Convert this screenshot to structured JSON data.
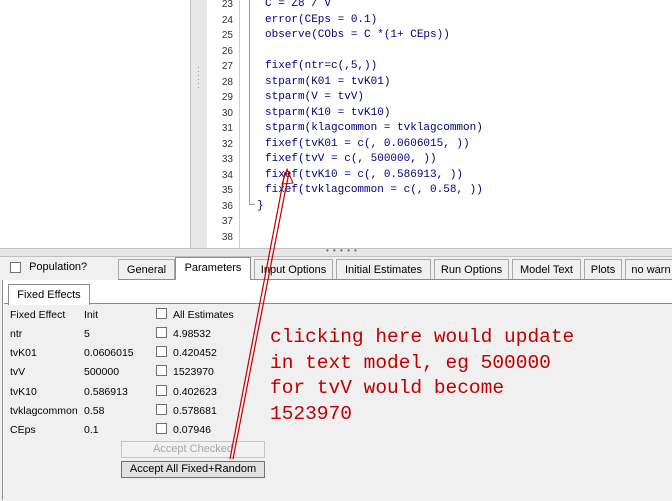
{
  "editor": {
    "lines": [
      {
        "n": "23",
        "text": "C = Z8 / V"
      },
      {
        "n": "24",
        "text": "error(CEps = 0.1)"
      },
      {
        "n": "25",
        "text": "observe(CObs = C *(1+ CEps))"
      },
      {
        "n": "26",
        "text": ""
      },
      {
        "n": "27",
        "text": "fixef(ntr=c(,5,))"
      },
      {
        "n": "28",
        "text": "stparm(K01 = tvK01)"
      },
      {
        "n": "29",
        "text": "stparm(V = tvV)"
      },
      {
        "n": "30",
        "text": "stparm(K10 = tvK10)"
      },
      {
        "n": "31",
        "text": "stparm(klagcommon = tvklagcommon)"
      },
      {
        "n": "32",
        "text": "fixef(tvK01 = c(, 0.0606015, ))"
      },
      {
        "n": "33",
        "text": "fixef(tvV = c(, 500000, ))"
      },
      {
        "n": "34",
        "text": "fixef(tvK10 = c(, 0.586913, ))"
      },
      {
        "n": "35",
        "text": "fixef(tvklagcommon = c(, 0.58, ))"
      },
      {
        "n": "36",
        "text": "}"
      },
      {
        "n": "37",
        "text": ""
      },
      {
        "n": "38",
        "text": ""
      }
    ]
  },
  "population_label": "Population?",
  "tabs": [
    "General",
    "Parameters",
    "Input Options",
    "Initial Estimates",
    "Run Options",
    "Model Text",
    "Plots",
    "no warn"
  ],
  "subtab": "Fixed Effects",
  "table": {
    "headers": {
      "effect": "Fixed Effect",
      "init": "Init",
      "all": "All Estimates"
    },
    "rows": [
      {
        "name": "ntr",
        "init": "5",
        "estimate": "4.98532"
      },
      {
        "name": "tvK01",
        "init": "0.0606015",
        "estimate": "0.420452"
      },
      {
        "name": "tvV",
        "init": "500000",
        "estimate": "1523970"
      },
      {
        "name": "tvK10",
        "init": "0.586913",
        "estimate": "0.402623"
      },
      {
        "name": "tvklagcommon",
        "init": "0.58",
        "estimate": "0.578681"
      },
      {
        "name": "CEps",
        "init": "0.1",
        "estimate": "0.07946"
      }
    ]
  },
  "buttons": {
    "accept_checked": "Accept Checked",
    "accept_all": "Accept All Fixed+Random"
  },
  "annotation": {
    "lines": [
      "clicking here would update",
      "in text model, eg 500000",
      "for tvV would become",
      "1523970"
    ],
    "color": "#c00000"
  }
}
